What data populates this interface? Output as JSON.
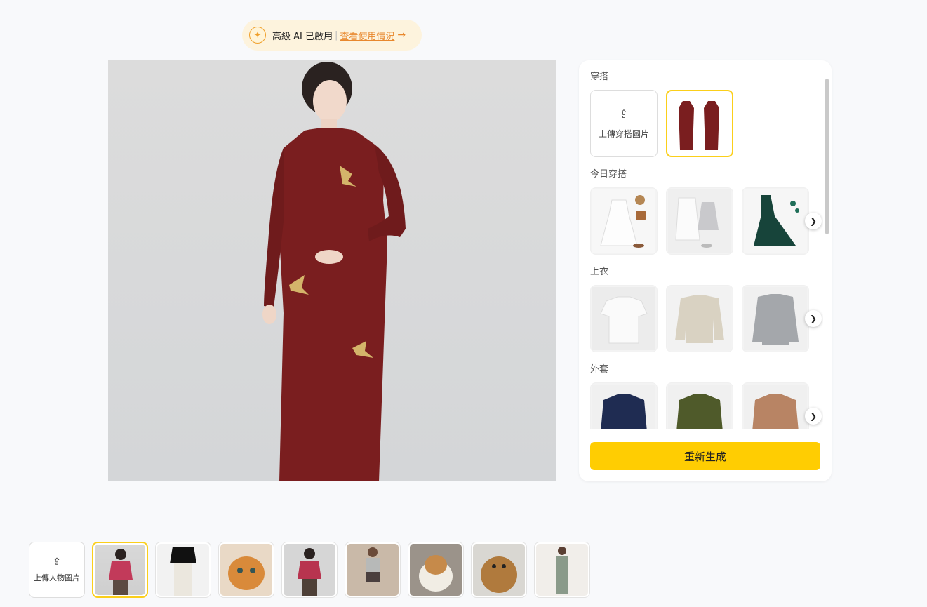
{
  "banner": {
    "status": "高級 AI 已啟用",
    "separator": "|",
    "link": "查看使用情況",
    "arrow": "→"
  },
  "panel": {
    "outfit_section": "穿搭",
    "upload_outfit": "上傳穿搭圖片",
    "today_section": "今日穿搭",
    "tops_section": "上衣",
    "coats_section": "外套",
    "regenerate": "重新生成"
  },
  "strip": {
    "upload_person": "上傳人物圖片"
  },
  "colors": {
    "accent": "#ffcd02",
    "selected_border": "#fbcf1a",
    "link": "#e8872c",
    "dress": "#7a1e1f"
  }
}
